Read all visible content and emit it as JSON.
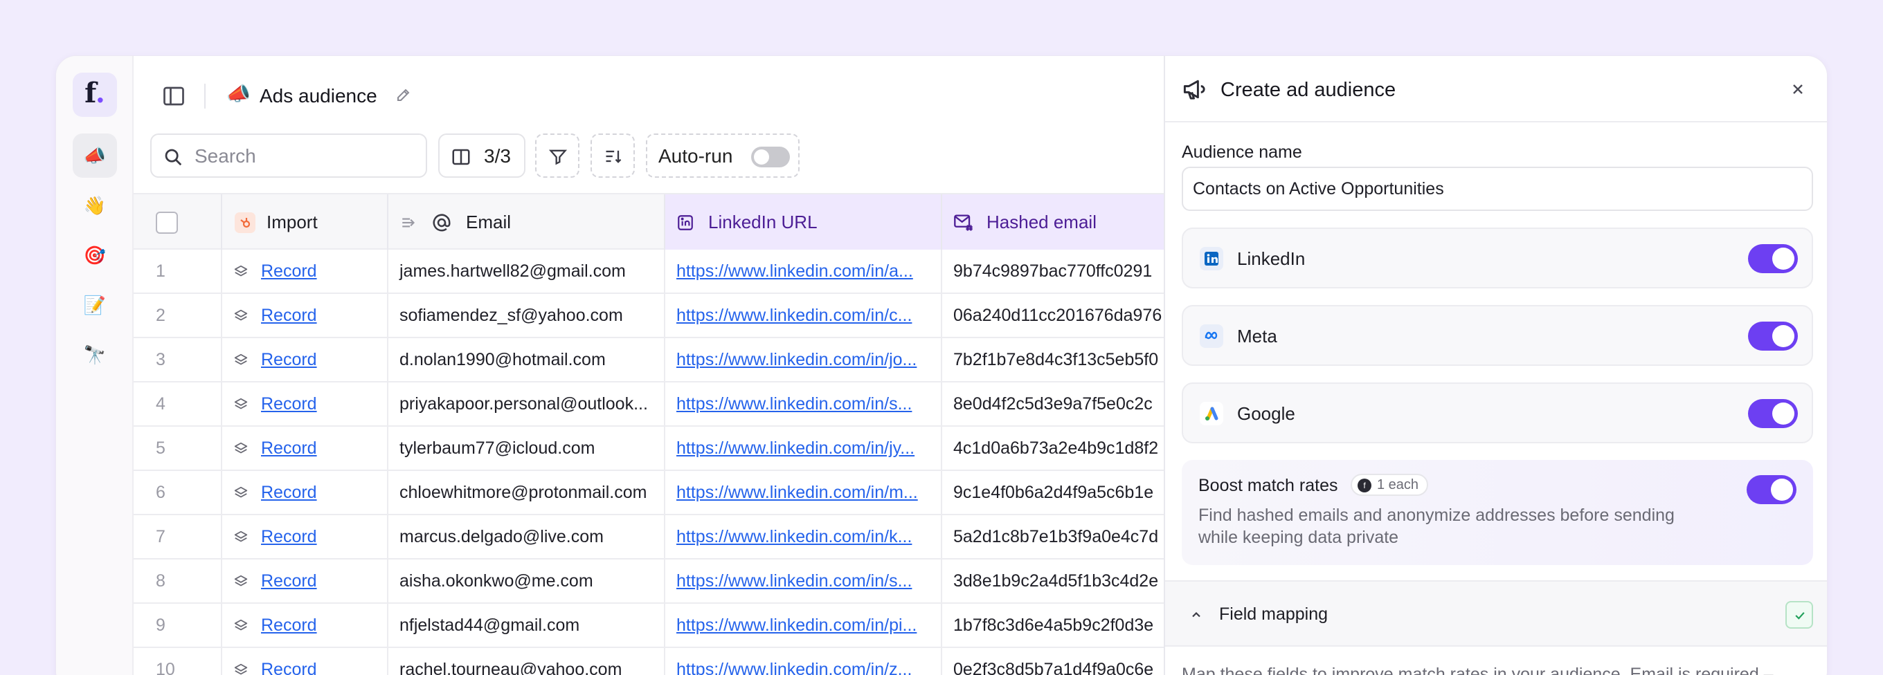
{
  "rail": {
    "logo_letter": "f",
    "logo_dot": ".",
    "items": [
      {
        "emoji": "📣",
        "icon": "megaphone-icon"
      },
      {
        "emoji": "👋",
        "icon": "waving-hand-icon"
      },
      {
        "emoji": "🎯",
        "icon": "target-icon"
      },
      {
        "emoji": "📝",
        "icon": "memo-icon"
      },
      {
        "emoji": "🔭",
        "icon": "telescope-icon"
      }
    ]
  },
  "header": {
    "emoji": "📣",
    "title": "Ads audience"
  },
  "toolbar": {
    "search_placeholder": "Search",
    "columns_count": "3/3",
    "autorun_label": "Auto-run"
  },
  "table": {
    "columns": {
      "import": "Import",
      "email": "Email",
      "linkedin": "LinkedIn URL",
      "hashed": "Hashed email"
    },
    "rows": [
      {
        "n": "1",
        "rec": "Record",
        "email": "james.hartwell82@gmail.com",
        "li": "https://www.linkedin.com/in/a...",
        "hash": "9b74c9897bac770ffc0291"
      },
      {
        "n": "2",
        "rec": "Record",
        "email": "sofiamendez_sf@yahoo.com",
        "li": "https://www.linkedin.com/in/c...",
        "hash": "06a240d11cc201676da976"
      },
      {
        "n": "3",
        "rec": "Record",
        "email": "d.nolan1990@hotmail.com",
        "li": "https://www.linkedin.com/in/jo...",
        "hash": "7b2f1b7e8d4c3f13c5eb5f0"
      },
      {
        "n": "4",
        "rec": "Record",
        "email": "priyakapoor.personal@outlook...",
        "li": "https://www.linkedin.com/in/s...",
        "hash": "8e0d4f2c5d3e9a7f5e0c2c"
      },
      {
        "n": "5",
        "rec": "Record",
        "email": "tylerbaum77@icloud.com",
        "li": "https://www.linkedin.com/in/jy...",
        "hash": "4c1d0a6b73a2e4b9c1d8f2"
      },
      {
        "n": "6",
        "rec": "Record",
        "email": "chloewhitmore@protonmail.com",
        "li": "https://www.linkedin.com/in/m...",
        "hash": "9c1e4f0b6a2d4f9a5c6b1e"
      },
      {
        "n": "7",
        "rec": "Record",
        "email": "marcus.delgado@live.com",
        "li": "https://www.linkedin.com/in/k...",
        "hash": "5a2d1c8b7e1b3f9a0e4c7d"
      },
      {
        "n": "8",
        "rec": "Record",
        "email": "aisha.okonkwo@me.com",
        "li": "https://www.linkedin.com/in/s...",
        "hash": "3d8e1b9c2a4d5f1b3c4d2e"
      },
      {
        "n": "9",
        "rec": "Record",
        "email": "nfjelstad44@gmail.com",
        "li": "https://www.linkedin.com/in/pi...",
        "hash": "1b7f8c3d6e4a5b9c2f0d3e"
      },
      {
        "n": "10",
        "rec": "Record",
        "email": "rachel.tourneau@yahoo.com",
        "li": "https://www.linkedin.com/in/z...",
        "hash": "0e2f3c8d5b7a1d4f9a0c6e"
      }
    ]
  },
  "panel": {
    "title": "Create ad audience",
    "audience_label": "Audience name",
    "audience_value": "Contacts on Active Opportunities",
    "platforms": [
      {
        "name": "LinkedIn",
        "icon": "linkedin-icon",
        "enabled": true
      },
      {
        "name": "Meta",
        "icon": "meta-icon",
        "enabled": true
      },
      {
        "name": "Google",
        "icon": "google-ads-icon",
        "enabled": true
      }
    ],
    "boost": {
      "title": "Boost match rates",
      "cost": "1 each",
      "description": "Find hashed emails and anonymize addresses before sending while keeping data private",
      "enabled": true
    },
    "field_mapping": {
      "title": "Field mapping",
      "description": "Map these fields to improve match rates in your audience. Email is required –"
    }
  },
  "colors": {
    "accent": "#6d3ff2",
    "link": "#2563eb",
    "background": "#f1ecfd",
    "purple_header": "#efe8fe"
  }
}
